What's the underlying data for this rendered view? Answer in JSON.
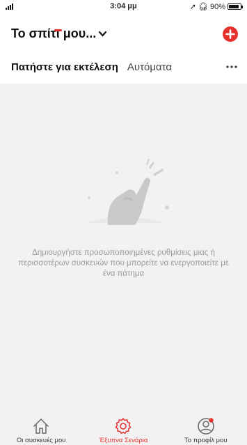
{
  "status_bar": {
    "time": "3:04 μμ",
    "battery": "90%",
    "battery_level": 0.9
  },
  "header": {
    "home_title": "Το σπίτι μου...",
    "add_icon": "plus-circle-icon",
    "more_icon": "more-horizontal-icon"
  },
  "tabs": [
    {
      "label": "Πατήστε για εκτέλεση",
      "active": true
    },
    {
      "label": "Αυτόματα",
      "active": false
    }
  ],
  "empty_state": {
    "icon": "tap-hand-icon",
    "message": "Δημιουργήστε προσωποποιημένες ρυθμίσεις μιας ή περισσοτέρων συσκευών που μπορείτε να ενεργοποιείτε με ένα πάτημα"
  },
  "tabbar": [
    {
      "label": "Οι συσκευές μου",
      "icon": "home-icon",
      "active": false
    },
    {
      "label": "Έξυπνα Σενάρια",
      "icon": "gear-icon",
      "active": true
    },
    {
      "label": "Το προφίλ μου",
      "icon": "profile-icon",
      "active": false
    }
  ],
  "colors": {
    "accent": "#e5302d",
    "background": "#f2f2f2",
    "header": "#ffffff",
    "muted_text": "#9a9a9a"
  }
}
